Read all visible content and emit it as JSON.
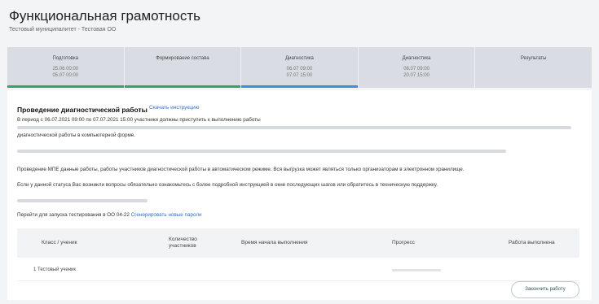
{
  "header": {
    "title": "Функциональная грамотность",
    "subtitle": "Тестовый муниципалитет - Тестовая ОО"
  },
  "stages": [
    {
      "name": "Подготовка",
      "dates": [
        "25.06 00:00",
        "05.07 00:00"
      ],
      "status": "green"
    },
    {
      "name": "Формирование состава",
      "dates": [],
      "status": "green"
    },
    {
      "name": "Диагностика",
      "dates": [
        "06.07 09:00",
        "07.07 15:00"
      ],
      "status": "blue"
    },
    {
      "name": "Диагностика",
      "dates": [
        "08.07 09:00",
        "20.07 15:00"
      ],
      "status": "none"
    },
    {
      "name": "Результаты",
      "dates": [],
      "status": "none"
    }
  ],
  "panel": {
    "title": "Проведение диагностической работы",
    "instruction_link": "Скачать инструкцию",
    "line1": "В период с 06.07.2021 09:00 по 07.07.2021 15:00 участники должны приступить к выполнению работы",
    "line2": "диагностической работы в компьютерной форме.",
    "line3": "Проведение МПЕ данные работы, работы участников диагностической работы в автоматическом режиме. Вся выгрузка может являться только организаторам в электронном хранилище.",
    "line4": "Если у данной статуса Вас возникли вопросы обязательно ознакомьтесь с более подробной инструкцией в окне последующих шагов или обратитесь в техническую поддержку.",
    "line5": "Перейти для запуска тестирования в ОО 04-22 ",
    "line5_link": "Сгенерировать новые пароли"
  },
  "table": {
    "headers": [
      "Класс / ученик",
      "Количество участников",
      "Время начала выполнения",
      "Прогресс",
      "Работа выполнена"
    ],
    "row": [
      "1 Тестовый ученик",
      "",
      "",
      "",
      ""
    ]
  },
  "action_button": "Закончить работу"
}
